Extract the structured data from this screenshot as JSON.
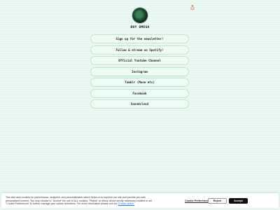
{
  "header": {
    "share_icon": "share-icon"
  },
  "profile": {
    "name": "BOY OMEGA",
    "avatar_icon": "avatar"
  },
  "links": [
    {
      "label": "Sign up for the newsletter!"
    },
    {
      "label": "Follow & stream on Spotify!"
    },
    {
      "label": "Official Youtube Channel"
    },
    {
      "label": "Instagram"
    },
    {
      "label": "Tumblr (Muse etc)"
    },
    {
      "label": "Facebook"
    },
    {
      "label": "Soundcloud"
    }
  ],
  "cookie_banner": {
    "text": "This site uses cookies for performance, analytics, and personalization which helps us to improve our site and provide you with personalized content. You may choose to \"Accept\" the use of ALL cookies, \"Reject\" to refuse all but strictly necessary cookies or set \"Cookie Preferences\" to further manage your cookie selections. For more information please see our",
    "link_text": "Cookie Notice.",
    "preferences_label": "Cookie Preferences",
    "reject_label": "Reject",
    "accept_label": "Accept"
  },
  "colors": {
    "background": "#e6f7ef",
    "accent": "#d14b4b",
    "button_border": "#bfe3cf"
  }
}
